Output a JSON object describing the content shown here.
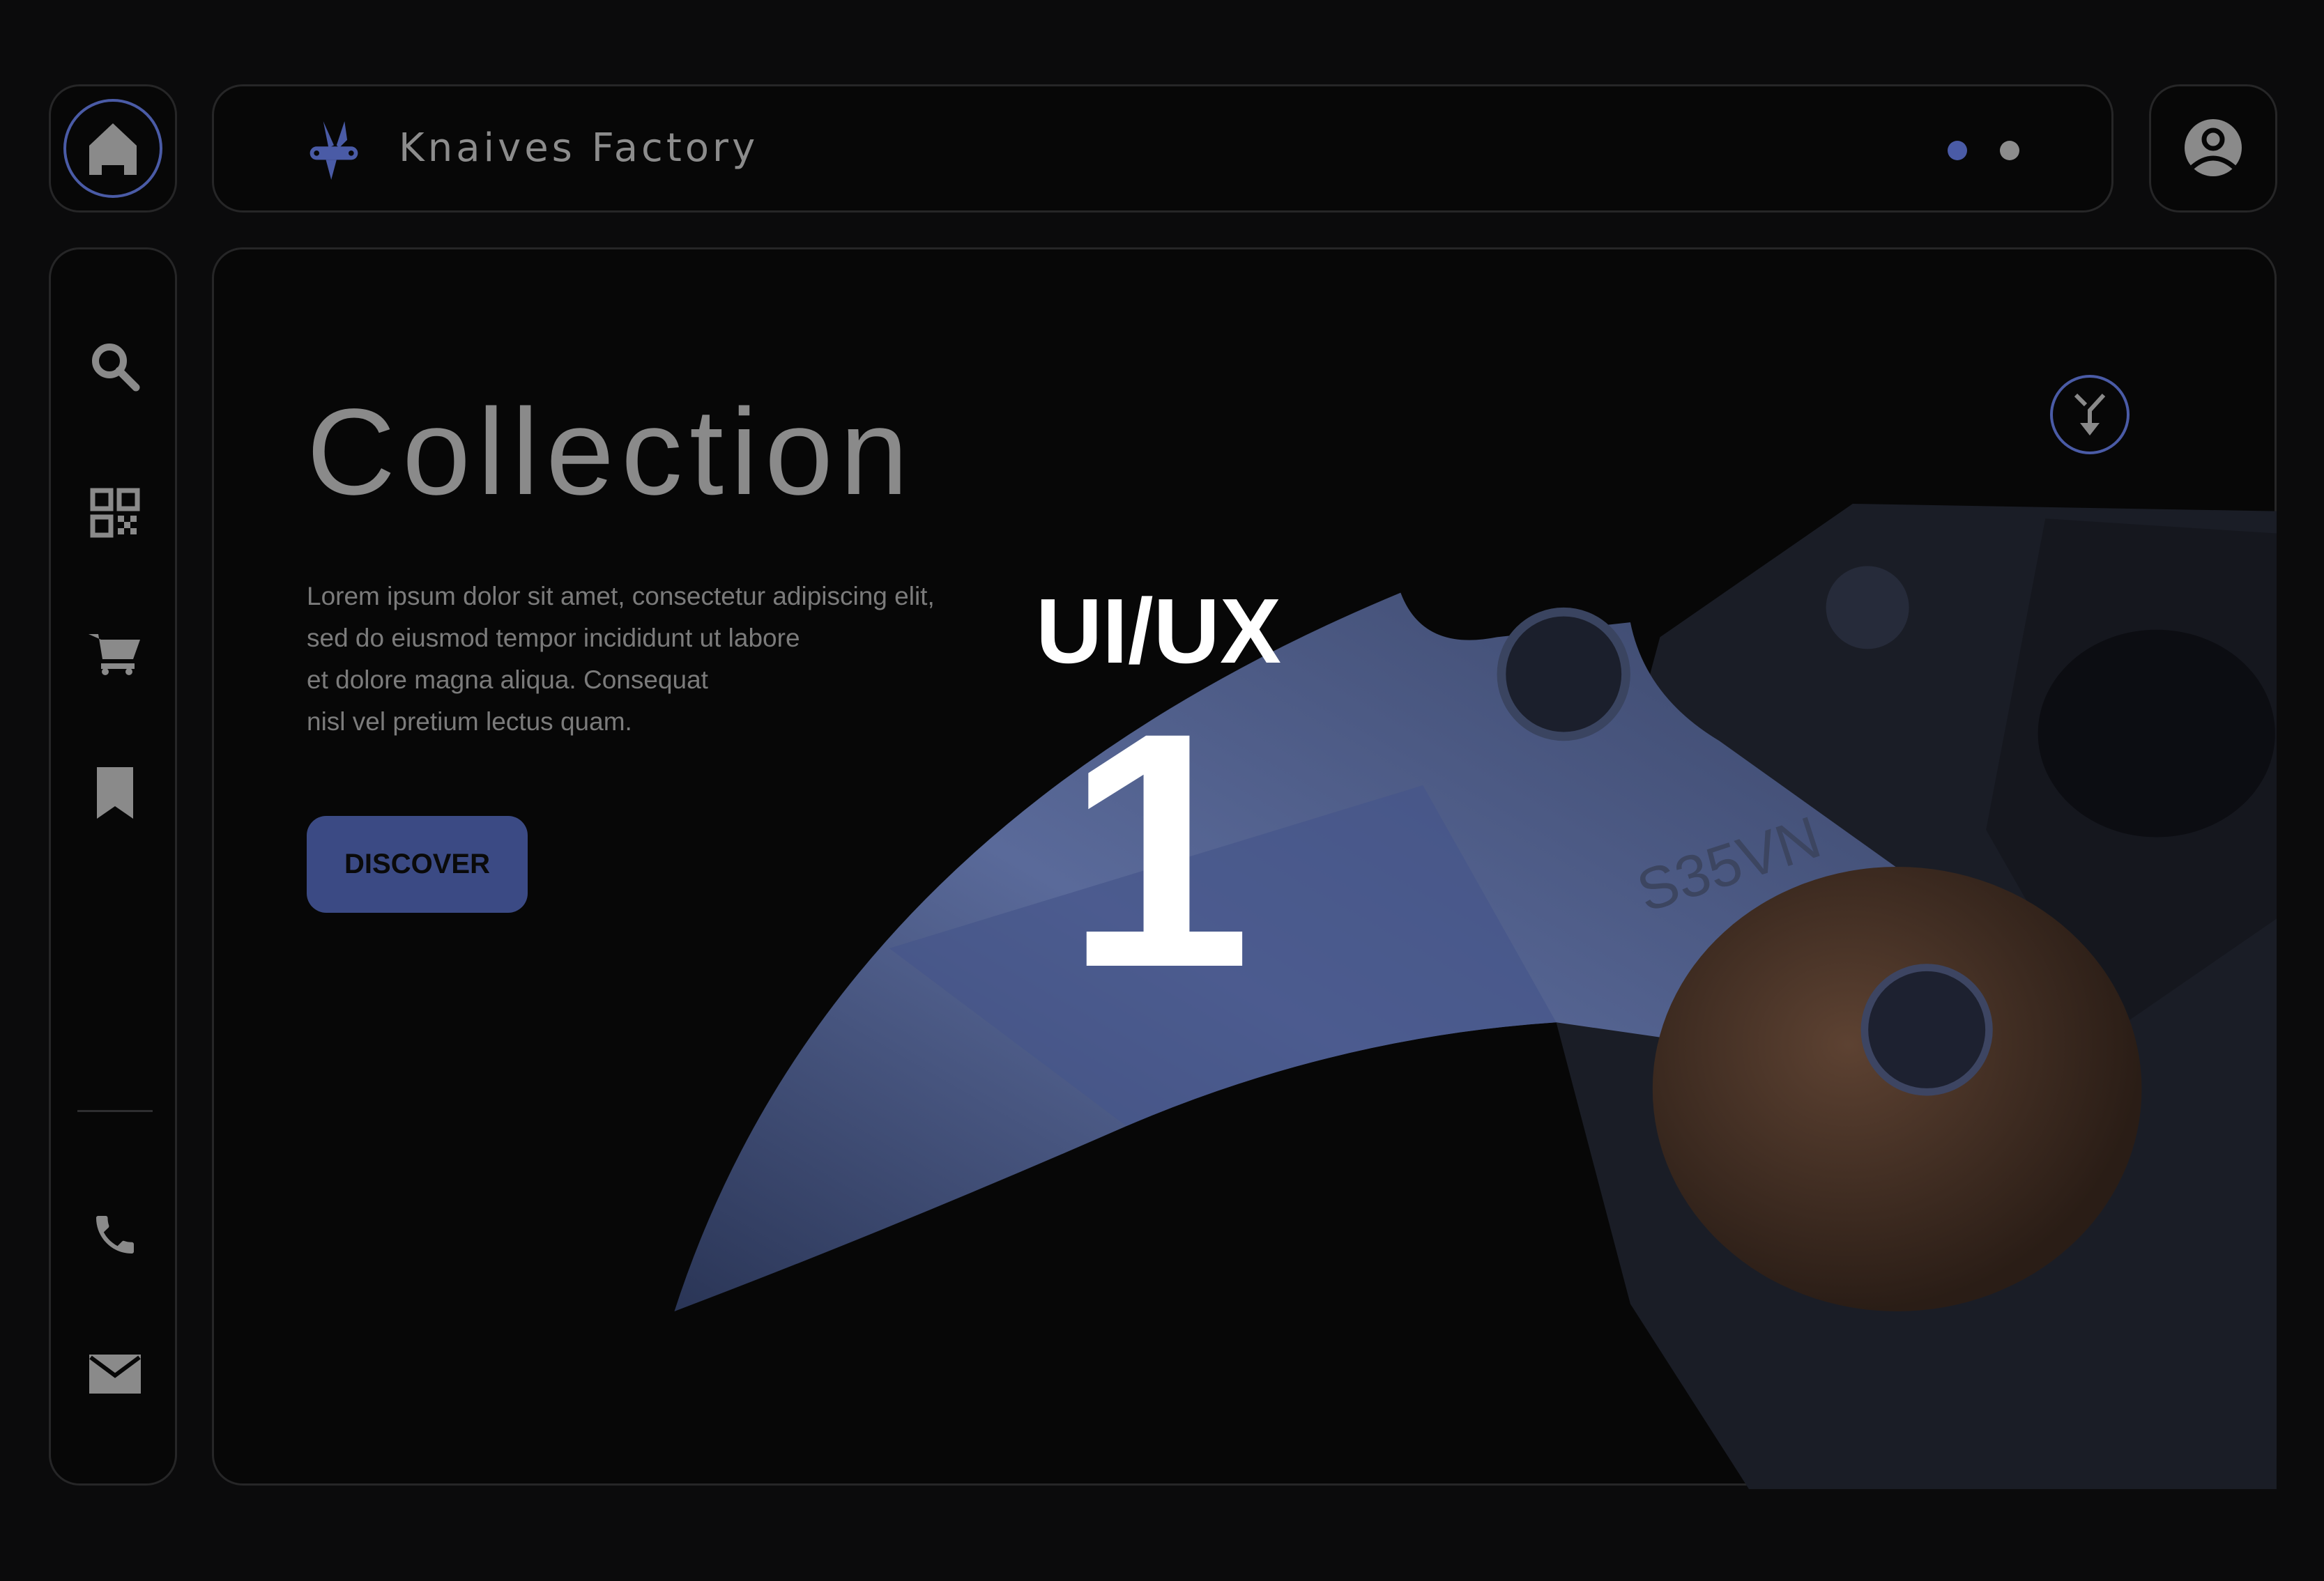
{
  "header": {
    "brand": "Knaives Factory",
    "logo_icon": "knife-logo-icon",
    "pagination": {
      "active_index": 0,
      "count": 2,
      "active_color": "#4a5ba6",
      "inactive_color": "#8c8c8c"
    }
  },
  "sidebar": {
    "home_icon": "home-icon",
    "items": [
      {
        "icon": "search-icon"
      },
      {
        "icon": "qr-code-icon"
      },
      {
        "icon": "cart-icon"
      },
      {
        "icon": "bookmark-icon"
      },
      {
        "icon": "phone-icon"
      },
      {
        "icon": "mail-icon"
      }
    ]
  },
  "hero": {
    "title": "Collection",
    "description": [
      "Lorem ipsum dolor sit amet, consectetur adipiscing elit,",
      "sed do eiusmod tempor incididunt ut labore",
      "et dolore magna aliqua. Consequat",
      "nisl vel pretium lectus quam."
    ],
    "cta_label": "DISCOVER",
    "blade_engraving": "S35VN"
  },
  "overlay": {
    "label": "UI/UX",
    "number": "1"
  },
  "colors": {
    "accent": "#4a5ba6",
    "button": "#3b4a84",
    "background": "#0b0b0c"
  }
}
